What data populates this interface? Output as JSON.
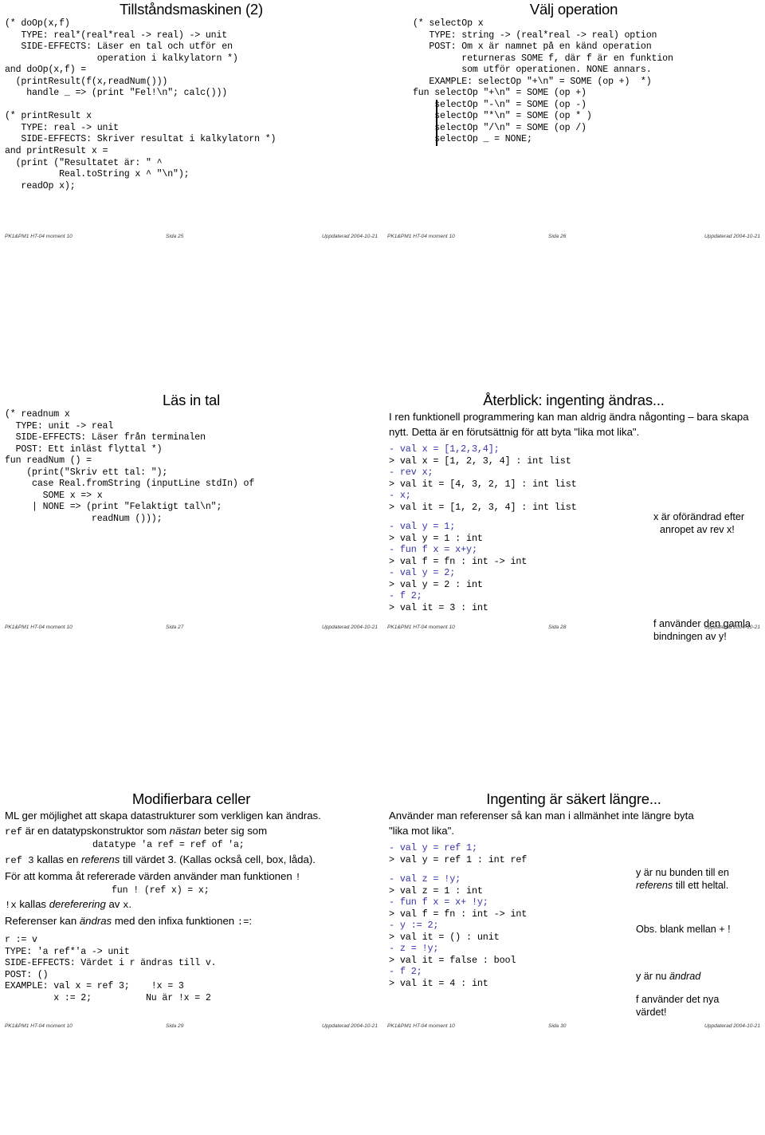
{
  "document": {
    "kind": "lecture-handout",
    "columns": 2,
    "rows": 3,
    "colors": {
      "input_blue": "#3333a8",
      "sideeffect_red": "#c0392b",
      "text": "#000000",
      "background": "#ffffff"
    }
  },
  "footer_common": {
    "course": "PK1&PM1 HT-04 moment 10",
    "updated": "Uppdaterad 2004-10-21"
  },
  "slides": [
    {
      "id": "slide-25",
      "title": "Tillståndsmaskinen (2)",
      "page_label": "Sida 25",
      "code": "(* doOp(x,f)\n   TYPE: real*(real*real -> real) -> unit\n   SIDE-EFFECTS: Läser en tal och utför en\n                 operation i kalkylatorn *)\nand doOp(x,f) =\n  (printResult(f(x,readNum()))\n    handle _ => (print \"Fel!\\n\"; calc()))\n\n(* printResult x\n   TYPE: real -> unit\n   SIDE-EFFECTS: Skriver resultat i kalkylatorn *)\nand printResult x =\n  (print (\"Resultatet är: \" ^\n          Real.toString x ^ \"\\n\");\n   readOp x);"
    },
    {
      "id": "slide-26",
      "title": "Välj operation",
      "page_label": "Sida 26",
      "code_head": "(* selectOp x\n   TYPE: string -> (real*real -> real) option\n   POST: Om x är namnet på en känd operation\n         returneras SOME f, där f är en funktion\n         som utför operationen. NONE annars.\n   EXAMPLE: selectOp \"+\\n\" = SOME (op +)  *)",
      "clauses": [
        "fun selectOp \"+\\n\" = SOME (op +)",
        "    selectOp \"-\\n\" = SOME (op -)",
        "    selectOp \"*\\n\" = SOME (op * )",
        "    selectOp \"/\\n\" = SOME (op /)",
        "    selectOp _ = NONE;"
      ]
    },
    {
      "id": "slide-27",
      "title": "Läs in tal",
      "page_label": "Sida 27",
      "code": "(* readnum x\n  TYPE: unit -> real\n  SIDE-EFFECTS: Läser från terminalen\n  POST: Ett inläst flyttal *)\nfun readNum () =\n    (print(\"Skriv ett tal: \");\n     case Real.fromString (inputLine stdIn) of\n       SOME x => x\n     | NONE => (print \"Felaktigt tal\\n\";\n                readNum ()));"
    },
    {
      "id": "slide-28",
      "title": "Återblick: ingenting ändras...",
      "page_label": "Sida 28",
      "intro": "I ren funktionell programmering kan man aldrig ändra någonting – bara skapa nytt. Detta är en förutsättnig för att byta \"lika mot lika\".",
      "transcript": [
        {
          "type": "input",
          "text": "- val x = [1,2,3,4];"
        },
        {
          "type": "output",
          "text": "> val x = [1, 2, 3, 4] : int list"
        },
        {
          "type": "input",
          "text": "- rev x;"
        },
        {
          "type": "output",
          "text": "> val it = [4, 3, 2, 1] : int list"
        },
        {
          "type": "input",
          "text": "- x;"
        },
        {
          "type": "output",
          "text": "> val it = [1, 2, 3, 4] : int list"
        },
        {
          "type": "gap",
          "text": ""
        },
        {
          "type": "input",
          "text": "- val y = 1;"
        },
        {
          "type": "output",
          "text": "> val y = 1 : int"
        },
        {
          "type": "input",
          "text": "- fun f x = x+y;"
        },
        {
          "type": "output",
          "text": "> val f = fn : int -> int"
        },
        {
          "type": "input",
          "text": "- val y = 2;"
        },
        {
          "type": "output",
          "text": "> val y = 2 : int"
        },
        {
          "type": "input",
          "text": "- f 2;"
        },
        {
          "type": "output",
          "text": "> val it = 3 : int"
        }
      ],
      "notes": [
        {
          "line1": "x är oförändrad efter",
          "line2": "anropet av rev x!"
        },
        {
          "line1": "f använder den gamla",
          "line2": "bindningen av y!"
        }
      ]
    },
    {
      "id": "slide-29",
      "title": "Modifierbara celler",
      "page_label": "Sida 29",
      "lines": [
        "ML ger möjlighet att skapa datastrukturer som verkligen kan ändras.",
        "ref är en datatypskonstruktor som nästan beter sig som",
        "datatype 'a ref = ref of 'a;",
        "ref 3 kallas en referens till värdet 3. (Kallas också cell, box, låda).",
        "För att komma åt refererade värden använder man funktionen !",
        "fun ! (ref x) = x;",
        "!x kallas dereferering av x.",
        "Referenser kan ändras med den infixa funktionen :=:"
      ],
      "spec": {
        "l1": "r := v",
        "l2": "TYPE: 'a ref*'a -> unit",
        "l3": "SIDE-EFFECTS: Värdet i r ändras till v.",
        "l4": "POST: ()",
        "l5": "EXAMPLE: val x = ref 3;    !x = 3",
        "l6": "         x := 2;          Nu är !x = 2"
      }
    },
    {
      "id": "slide-30",
      "title": "Ingenting är säkert längre...",
      "page_label": "Sida 30",
      "intro_l1": "Använder man referenser så kan man i allmänhet inte längre byta",
      "intro_l2": "\"lika mot lika\".",
      "transcript": [
        {
          "type": "input",
          "text": "- val y = ref 1;"
        },
        {
          "type": "output",
          "text": "> val y = ref 1 : int ref"
        },
        {
          "type": "gap",
          "text": ""
        },
        {
          "type": "input",
          "text": "- val z = !y;"
        },
        {
          "type": "output",
          "text": "> val z = 1 : int"
        },
        {
          "type": "input",
          "text": "- fun f x = x+ !y;"
        },
        {
          "type": "output",
          "text": "> val f = fn : int -> int"
        },
        {
          "type": "input",
          "text": "- y := 2;"
        },
        {
          "type": "output",
          "text": "> val it = () : unit"
        },
        {
          "type": "input",
          "text": "- z = !y;"
        },
        {
          "type": "output",
          "text": "> val it = false : bool"
        },
        {
          "type": "input",
          "text": "- f 2;"
        },
        {
          "type": "output",
          "text": "> val it = 4 : int"
        }
      ],
      "notes": [
        {
          "line1": "y är nu bunden till en",
          "line2": "referens till ett heltal."
        },
        {
          "line1": "Obs. blank mellan +  !",
          "line2": ""
        },
        {
          "line1": "y är nu ändrad",
          "line2": ""
        },
        {
          "line1": "f använder det nya",
          "line2": "värdet!"
        }
      ]
    }
  ]
}
